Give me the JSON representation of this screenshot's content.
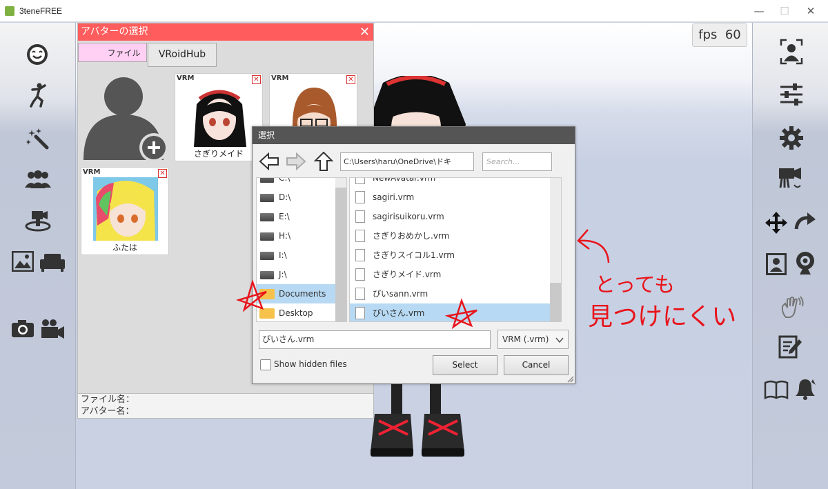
{
  "window": {
    "title": "3teneFREE",
    "minimize": "—",
    "maximize": "☐",
    "close": "✕"
  },
  "fps": {
    "label": "fps",
    "value": "60"
  },
  "left_sidebar": [
    "face-icon",
    "pose-icon",
    "magic-wand-icon",
    "group-icon",
    "camera-stage-icon",
    "image-icon",
    "sofa-icon",
    "photo-camera-icon",
    "video-camera-icon"
  ],
  "right_sidebar": [
    "face-tracking-icon",
    "sliders-icon",
    "gear-icon",
    "camera-rotate-icon",
    "move-icon",
    "redo-icon",
    "portrait-icon",
    "webcam-icon",
    "hand-icon",
    "edit-icon",
    "book-icon",
    "bell-icon"
  ],
  "avatar_panel": {
    "title": "アバターの選択",
    "close": "✕",
    "tabs": [
      "ファイル",
      "VRoidHub"
    ],
    "cards": [
      {
        "tag": "VRM",
        "remove": "✕",
        "name": "さぎりメイド"
      },
      {
        "tag": "VRM",
        "remove": "✕",
        "name": ""
      },
      {
        "tag": "VRM",
        "remove": "✕",
        "name": "ふたは"
      }
    ],
    "file_name_label": "ファイル名：",
    "avatar_name_label": "アバター名："
  },
  "dialog": {
    "title": "選択",
    "path": "C:\\Users\\haru\\OneDrive\\ドキ",
    "search_placeholder": "Search...",
    "drives": [
      "C:\\",
      "D:\\",
      "E:\\",
      "H:\\",
      "I:\\",
      "J:\\",
      "Documents",
      "Desktop"
    ],
    "selected_drive": "Documents",
    "files": [
      "NewAvatar.vrm",
      "sagiri.vrm",
      "sagirisuikoru.vrm",
      "さぎりおめかし.vrm",
      "さぎりスイコル1.vrm",
      "さぎりメイド.vrm",
      "ぴいsann.vrm",
      "ぴいさん.vrm"
    ],
    "selected_file": "ぴいさん.vrm",
    "filename_value": "ぴいさん.vrm",
    "filter": "VRM (.vrm)",
    "show_hidden_label": "Show hidden files",
    "select_label": "Select",
    "cancel_label": "Cancel"
  },
  "annotation": {
    "line1": "とっても",
    "line2": "見つけにくい",
    "color": "#e8141b"
  }
}
